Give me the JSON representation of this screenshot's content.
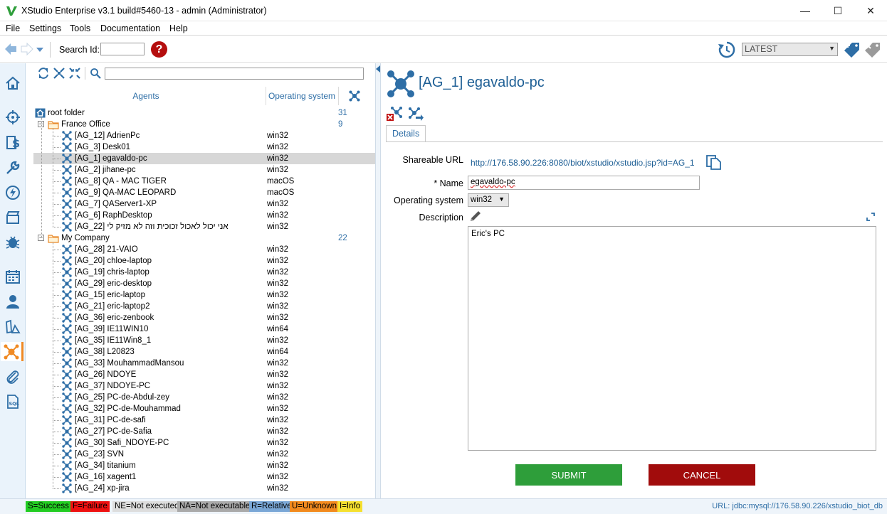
{
  "window": {
    "title": "XStudio Enterprise v3.1 build#5460-13 - admin (Administrator)",
    "minimize": "—",
    "maximize": "☐",
    "close": "✕"
  },
  "menu": [
    "File",
    "Settings",
    "Tools",
    "Documentation",
    "Help"
  ],
  "toolbar": {
    "search_label": "Search Id:",
    "search_value": "",
    "help": "?",
    "version": "LATEST"
  },
  "tree": {
    "col_agents": "Agents",
    "col_os": "Operating system",
    "root": {
      "label": "root folder",
      "count": "31"
    },
    "folders": [
      {
        "label": "France Office",
        "count": "9",
        "agents": [
          {
            "label": "[AG_12] AdrienPc",
            "os": "win32"
          },
          {
            "label": "[AG_3] Desk01",
            "os": "win32"
          },
          {
            "label": "[AG_1] egavaldo-pc",
            "os": "win32",
            "selected": true
          },
          {
            "label": "[AG_2] jihane-pc",
            "os": "win32"
          },
          {
            "label": "[AG_8] QA - MAC TIGER",
            "os": "macOS"
          },
          {
            "label": "[AG_9] QA-MAC LEOPARD",
            "os": "macOS"
          },
          {
            "label": "[AG_7] QAServer1-XP",
            "os": "win32"
          },
          {
            "label": "[AG_6] RaphDesktop",
            "os": "win32"
          },
          {
            "label": "[AG_22] אני יכול לאכול זכוכית וזה לא מזיק לי",
            "os": "win32"
          }
        ]
      },
      {
        "label": "My Company",
        "count": "22",
        "agents": [
          {
            "label": "[AG_28] 21-VAIO",
            "os": "win32"
          },
          {
            "label": "[AG_20] chloe-laptop",
            "os": "win32"
          },
          {
            "label": "[AG_19] chris-laptop",
            "os": "win32"
          },
          {
            "label": "[AG_29] eric-desktop",
            "os": "win32"
          },
          {
            "label": "[AG_15] eric-laptop",
            "os": "win32"
          },
          {
            "label": "[AG_21] eric-laptop2",
            "os": "win32"
          },
          {
            "label": "[AG_36] eric-zenbook",
            "os": "win32"
          },
          {
            "label": "[AG_39] IE11WIN10",
            "os": "win64"
          },
          {
            "label": "[AG_35] IE11Win8_1",
            "os": "win32"
          },
          {
            "label": "[AG_38] L20823",
            "os": "win64"
          },
          {
            "label": "[AG_33] MouhammadMansou",
            "os": "win32"
          },
          {
            "label": "[AG_26] NDOYE",
            "os": "win32"
          },
          {
            "label": "[AG_37] NDOYE-PC",
            "os": "win32"
          },
          {
            "label": "[AG_25] PC-de-Abdul-zey",
            "os": "win32"
          },
          {
            "label": "[AG_32] PC-de-Mouhammad",
            "os": "win32"
          },
          {
            "label": "[AG_31] PC-de-safi",
            "os": "win32"
          },
          {
            "label": "[AG_27] PC-de-Safia",
            "os": "win32"
          },
          {
            "label": "[AG_30] Safi_NDOYE-PC",
            "os": "win32"
          },
          {
            "label": "[AG_23] SVN",
            "os": "win32"
          },
          {
            "label": "[AG_34] titanium",
            "os": "win32"
          },
          {
            "label": "[AG_16] xagent1",
            "os": "win32"
          },
          {
            "label": "[AG_24] xp-jira",
            "os": "win32"
          }
        ]
      }
    ]
  },
  "detail": {
    "title": "[AG_1] egavaldo-pc",
    "tab": "Details",
    "url_label": "Shareable URL",
    "url": "http://176.58.90.226:8080/biot/xstudio/xstudio.jsp?id=AG_1",
    "name_label": "* Name",
    "name_value": "egavaldo-pc",
    "os_label": "Operating system",
    "os_value": "win32",
    "description_label": "Description",
    "description_value": "Eric's PC",
    "submit": "SUBMIT",
    "cancel": "CANCEL"
  },
  "status": {
    "legend": [
      {
        "text": "S=Success",
        "bg": "#22cc22",
        "fg": "#000000"
      },
      {
        "text": "F=Failure",
        "bg": "#ee1111",
        "fg": "#000000"
      },
      {
        "text": "NE=Not executed",
        "bg": "#dddddd",
        "fg": "#000000"
      },
      {
        "text": "NA=Not executable",
        "bg": "#aaaaaa",
        "fg": "#000000"
      },
      {
        "text": "R=Relative",
        "bg": "#7aa7d6",
        "fg": "#000000"
      },
      {
        "text": "U=Unknown",
        "bg": "#f28a1e",
        "fg": "#000000"
      },
      {
        "text": "I=Info",
        "bg": "#f5e030",
        "fg": "#000000"
      }
    ],
    "url_label": "URL:",
    "url_value": "jdbc:mysql://176.58.90.226/xstudio_biot_db"
  }
}
